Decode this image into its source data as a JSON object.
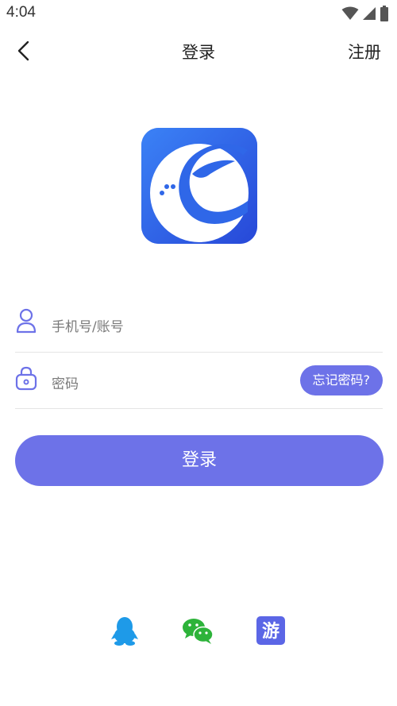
{
  "status_bar": {
    "time": "4:04",
    "icons": [
      "wifi-icon",
      "cell-signal-icon",
      "battery-icon"
    ]
  },
  "nav": {
    "title": "登录",
    "register_label": "注册",
    "back_icon": "chevron-left-icon"
  },
  "logo": {
    "icon": "app-logo",
    "colors": {
      "background": "#2f6cf0",
      "mark": "#ffffff"
    }
  },
  "form": {
    "account": {
      "icon": "user-icon",
      "placeholder": "手机号/账号",
      "value": ""
    },
    "password": {
      "icon": "lock-icon",
      "placeholder": "密码",
      "value": ""
    },
    "forgot_label": "忘记密码?"
  },
  "login_button": {
    "label": "登录"
  },
  "third_party": [
    {
      "name": "qq",
      "icon": "qq-penguin-icon",
      "color": "#1e9ae8"
    },
    {
      "name": "wechat",
      "icon": "wechat-icon",
      "color": "#2db33a"
    },
    {
      "name": "guest",
      "icon": "guest-icon",
      "label": "游",
      "color": "#5b66e6"
    }
  ],
  "colors": {
    "accent": "#6d72e8",
    "text": "#222222",
    "placeholder": "#7a7a7a",
    "divider": "#e4e4e4"
  }
}
